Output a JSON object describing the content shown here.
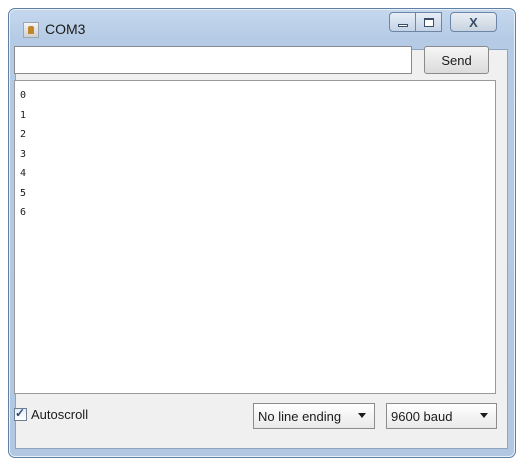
{
  "window": {
    "title": "COM3",
    "icons": {
      "app": "java-cup-icon",
      "minimize": "minimize-icon",
      "maximize": "maximize-icon",
      "close": "close-icon"
    },
    "close_glyph": "X"
  },
  "toolbar": {
    "input_value": "",
    "send_label": "Send"
  },
  "output": {
    "lines": [
      "0",
      "1",
      "2",
      "3",
      "4",
      "5",
      "6"
    ]
  },
  "status": {
    "autoscroll_label": "Autoscroll",
    "autoscroll_checked": true,
    "line_ending": "No line ending",
    "baud_rate": "9600 baud"
  },
  "colors": {
    "titlebar": "#b5cbe5",
    "client": "#f0f0f0",
    "text": "#1b1b1b"
  }
}
